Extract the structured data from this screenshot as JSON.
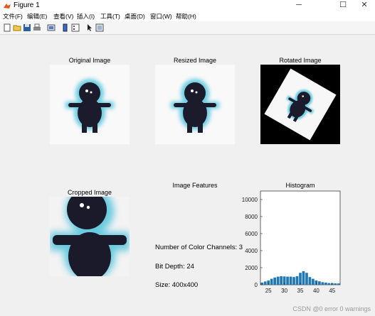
{
  "window": {
    "title": "Figure 1",
    "minimize": "─",
    "maximize": "☐",
    "close": "✕"
  },
  "menu": [
    "文件(F)",
    "编辑(E)",
    "查看(V)",
    "插入(I)",
    "工具(T)",
    "桌面(D)",
    "窗口(W)",
    "帮助(H)"
  ],
  "toolbar": [
    "new-figure-icon",
    "open-icon",
    "save-icon",
    "print-icon",
    "link-plot-icon",
    "insert-colorbar-icon",
    "insert-legend-icon",
    "pointer-icon",
    "plot-tools-icon"
  ],
  "panels": {
    "original": "Original Image",
    "resized": "Resized Image",
    "rotated": "Rotated Image",
    "cropped": "Cropped Image",
    "features": "Image Features",
    "histogram": "Histogram"
  },
  "features": {
    "channels": "Number of Color Channels: 3",
    "bit_depth": "Bit Depth: 24",
    "size": "Size: 400x400"
  },
  "watermark": "CSDN @0 error 0 warnings",
  "chart_data": {
    "type": "bar",
    "title": "Histogram",
    "xlabel": "",
    "ylabel": "",
    "x": [
      23,
      24,
      25,
      26,
      27,
      28,
      29,
      30,
      31,
      32,
      33,
      34,
      35,
      36,
      37,
      38,
      39,
      40,
      41,
      42,
      43,
      44,
      45,
      46,
      47
    ],
    "values": [
      250,
      380,
      500,
      700,
      850,
      950,
      1000,
      980,
      950,
      950,
      900,
      1000,
      1400,
      1600,
      1400,
      900,
      700,
      500,
      400,
      300,
      250,
      200,
      180,
      160,
      150
    ],
    "xlim": [
      22.5,
      47.5
    ],
    "ylim": [
      0,
      11000
    ],
    "xticks": [
      25,
      30,
      35,
      40,
      45
    ],
    "yticks": [
      0,
      2000,
      4000,
      6000,
      8000,
      10000
    ],
    "color": "#1f77b4"
  }
}
